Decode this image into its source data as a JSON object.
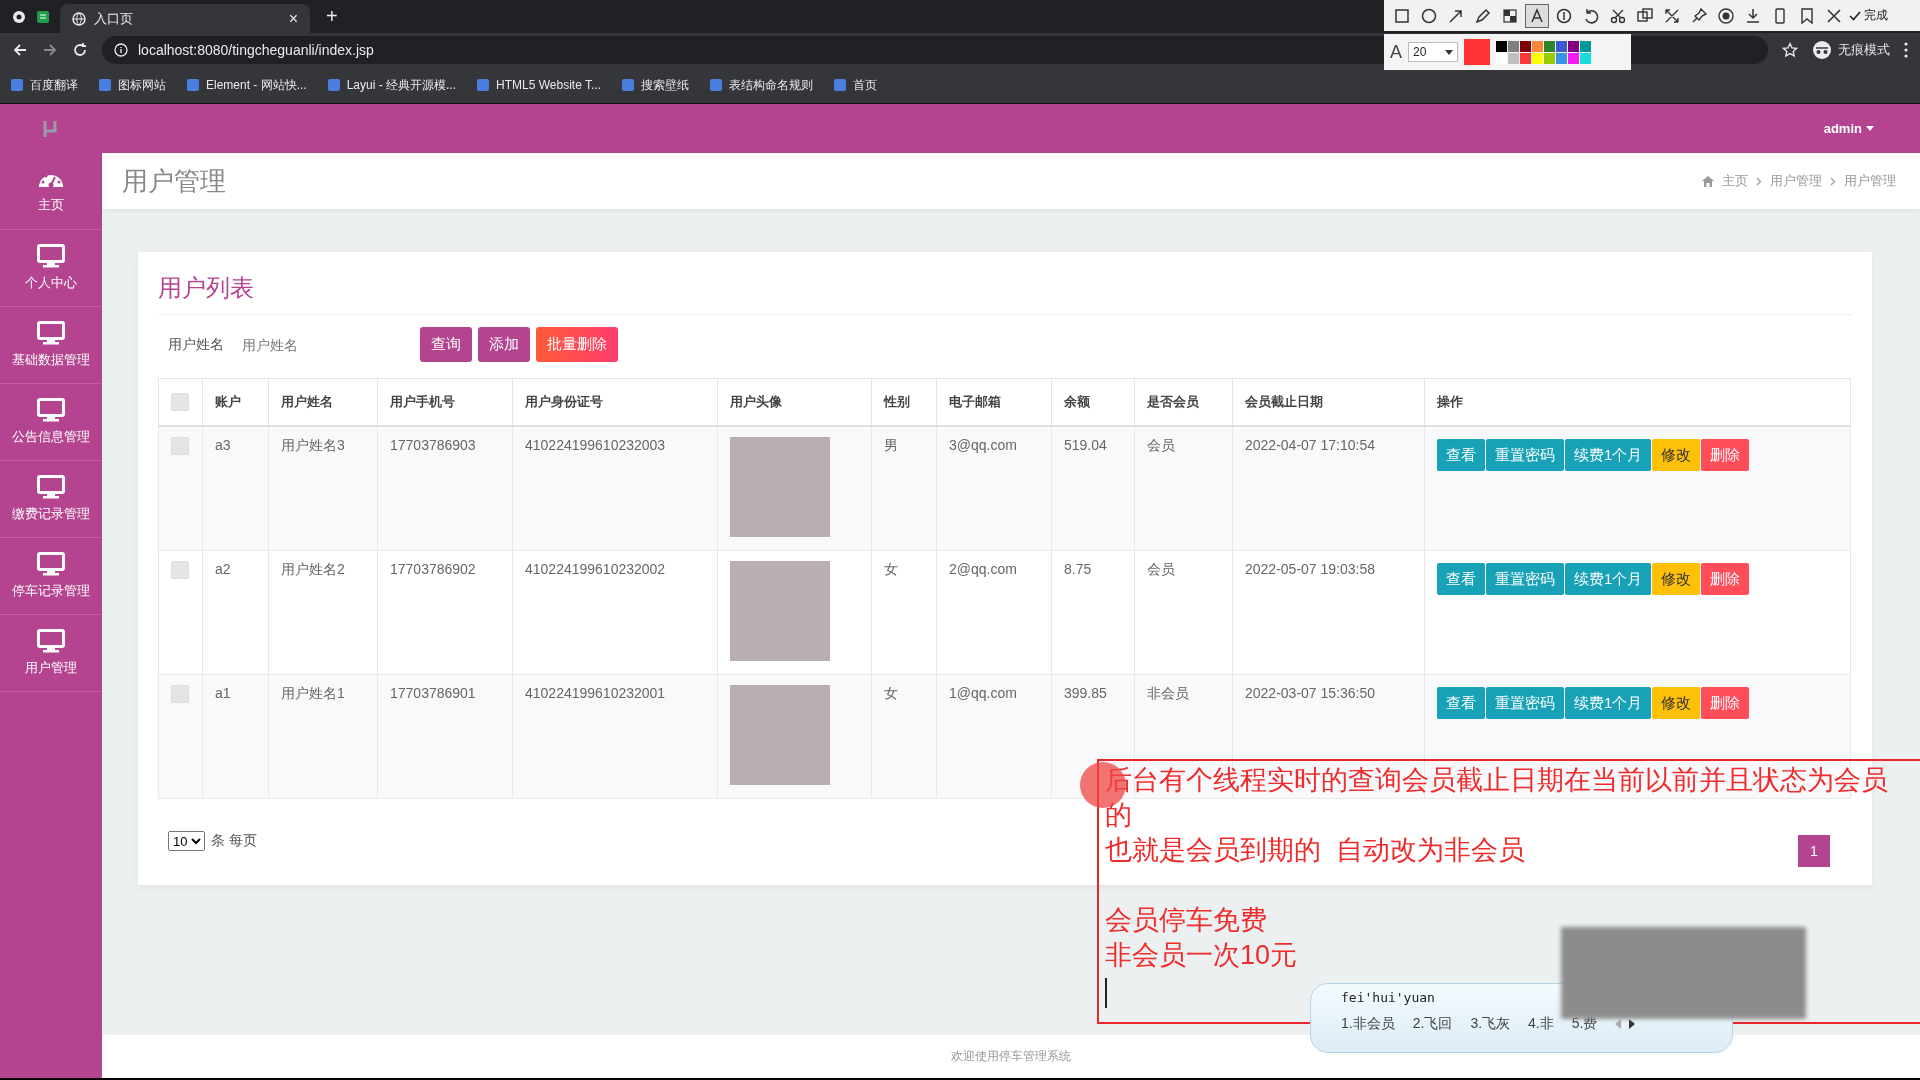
{
  "browser": {
    "tab": {
      "title": "入口页",
      "close": "×"
    },
    "new_tab": "+",
    "url": "localhost:8080/tingcheguanli/index.jsp",
    "profile": "无痕模式",
    "bookmarks": [
      {
        "label": "百度翻译"
      },
      {
        "label": "图标网站"
      },
      {
        "label": "Element - 网站快..."
      },
      {
        "label": "Layui - 经典开源模..."
      },
      {
        "label": "HTML5 Website T..."
      },
      {
        "label": "搜索壁纸"
      },
      {
        "label": "表结构命名规则"
      },
      {
        "label": "首页"
      }
    ]
  },
  "capture_toolbar": {
    "tools": [
      {
        "kind": "rect",
        "selected": false
      },
      {
        "kind": "ellipse",
        "selected": false
      },
      {
        "kind": "arrow",
        "selected": false
      },
      {
        "kind": "pen",
        "selected": false
      },
      {
        "kind": "mosaic",
        "selected": false
      },
      {
        "kind": "text",
        "selected": true
      },
      {
        "kind": "number",
        "selected": false
      },
      {
        "kind": "undo",
        "selected": false
      },
      {
        "kind": "cut",
        "selected": false
      },
      {
        "kind": "copy",
        "selected": false
      },
      {
        "kind": "expand",
        "selected": false
      },
      {
        "kind": "pin",
        "selected": false
      },
      {
        "kind": "record",
        "selected": false
      },
      {
        "kind": "download",
        "selected": false
      },
      {
        "kind": "phone",
        "selected": false
      },
      {
        "kind": "bookmark",
        "selected": false
      },
      {
        "kind": "close",
        "selected": false
      }
    ],
    "done": "完成",
    "font_label": "A",
    "font_size": "20",
    "palette": [
      {
        "color": "#000000"
      },
      {
        "color": "#808080"
      },
      {
        "color": "#800000"
      },
      {
        "color": "#f7883a"
      },
      {
        "color": "#308430"
      },
      {
        "color": "#385ad3"
      },
      {
        "color": "#800080"
      },
      {
        "color": "#009999"
      },
      {
        "color": "#ffffff"
      },
      {
        "color": "#c0c0c0"
      },
      {
        "color": "#fb3838"
      },
      {
        "color": "#ffff00"
      },
      {
        "color": "#99cc00"
      },
      {
        "color": "#3894e4"
      },
      {
        "color": "#f31bf3"
      },
      {
        "color": "#16dcdc"
      }
    ]
  },
  "header": {
    "user": "admin"
  },
  "sidebar": {
    "items": [
      {
        "kind": "dashboard",
        "label": "主页",
        "selected": false
      },
      {
        "kind": "monitor",
        "label": "个人中心",
        "selected": false
      },
      {
        "kind": "monitor",
        "label": "基础数据管理",
        "selected": false
      },
      {
        "kind": "monitor",
        "label": "公告信息管理",
        "selected": false
      },
      {
        "kind": "monitor",
        "label": "缴费记录管理",
        "selected": false
      },
      {
        "kind": "monitor",
        "label": "停车记录管理",
        "selected": false
      },
      {
        "kind": "monitor",
        "label": "用户管理",
        "selected": false
      }
    ]
  },
  "page": {
    "title": "用户管理",
    "breadcrumb": [
      "主页",
      "用户管理",
      "用户管理"
    ]
  },
  "card": {
    "title": "用户列表",
    "search": {
      "label": "用户姓名",
      "placeholder": "用户姓名"
    },
    "buttons": [
      {
        "kind": "primary",
        "label": "查询"
      },
      {
        "kind": "primary",
        "label": "添加"
      },
      {
        "kind": "danger",
        "label": "批量删除"
      }
    ],
    "table": {
      "select_all_checked": false,
      "columns": [
        {
          "kind": "text",
          "label": "账户"
        },
        {
          "kind": "text",
          "label": "用户姓名"
        },
        {
          "kind": "text",
          "label": "用户手机号"
        },
        {
          "kind": "text",
          "label": "用户身份证号"
        },
        {
          "kind": "photo",
          "label": "用户头像"
        },
        {
          "kind": "text",
          "label": "性别"
        },
        {
          "kind": "text",
          "label": "电子邮箱"
        },
        {
          "kind": "text",
          "label": "余额"
        },
        {
          "kind": "text",
          "label": "是否会员"
        },
        {
          "kind": "text",
          "label": "会员截止日期"
        },
        {
          "kind": "actions",
          "label": "操作"
        }
      ],
      "rows": [
        {
          "checked": false,
          "cells": [
            "a3",
            "用户姓名3",
            "17703786903",
            "410224199610232003",
            "",
            "男",
            "3@qq.com",
            "519.04",
            "会员",
            "2022-04-07 17:10:54"
          ],
          "actions": [
            {
              "kind": "info",
              "label": "查看"
            },
            {
              "kind": "info",
              "label": "重置密码"
            },
            {
              "kind": "info",
              "label": "续费1个月"
            },
            {
              "kind": "warning",
              "label": "修改"
            },
            {
              "kind": "danger",
              "label": "删除"
            }
          ]
        },
        {
          "checked": false,
          "cells": [
            "a2",
            "用户姓名2",
            "17703786902",
            "410224199610232002",
            "",
            "女",
            "2@qq.com",
            "8.75",
            "会员",
            "2022-05-07 19:03:58"
          ],
          "actions": [
            {
              "kind": "info",
              "label": "查看"
            },
            {
              "kind": "info",
              "label": "重置密码"
            },
            {
              "kind": "info",
              "label": "续费1个月"
            },
            {
              "kind": "warning",
              "label": "修改"
            },
            {
              "kind": "danger",
              "label": "删除"
            }
          ]
        },
        {
          "checked": false,
          "cells": [
            "a1",
            "用户姓名1",
            "17703786901",
            "410224199610232001",
            "",
            "女",
            "1@qq.com",
            "399.85",
            "非会员",
            "2022-03-07 15:36:50"
          ],
          "actions": [
            {
              "kind": "info",
              "label": "查看"
            },
            {
              "kind": "info",
              "label": "重置密码"
            },
            {
              "kind": "info",
              "label": "续费1个月"
            },
            {
              "kind": "warning",
              "label": "修改"
            },
            {
              "kind": "danger",
              "label": "删除"
            }
          ]
        }
      ]
    },
    "page_size": "10",
    "page_size_label": "条 每页",
    "pages": [
      {
        "label": "1",
        "selected": true
      }
    ]
  },
  "footer": "欢迎使用停车管理系统",
  "annotation": {
    "paragraphs": [
      [
        "后台有个线程实时的查询会员截止日期在当前以前并且状态为会员",
        "的",
        "也就是会员到期的  自动改为非会员"
      ],
      [
        "会员停车免费",
        "非会员一次10元"
      ]
    ]
  },
  "ime": {
    "input": "fei'hui'yuan",
    "candidates": [
      "1.非会员",
      "2.飞回",
      "3.飞灰",
      "4.非",
      "5.费"
    ]
  }
}
